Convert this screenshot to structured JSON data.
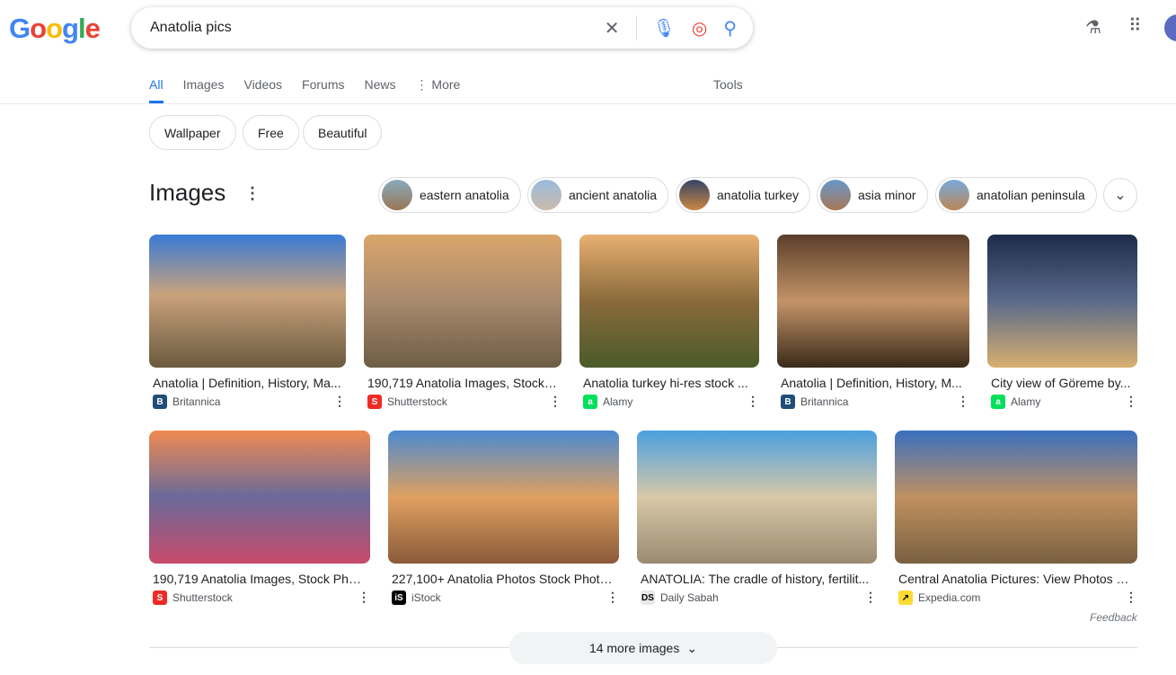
{
  "logo": "Google",
  "search": {
    "query": "Anatolia pics"
  },
  "tabs": [
    "All",
    "Images",
    "Videos",
    "Forums",
    "News",
    "More"
  ],
  "tools": "Tools",
  "chips": [
    "Wallpaper",
    "Free",
    "Beautiful"
  ],
  "images_heading": "Images",
  "related": [
    "eastern anatolia",
    "ancient anatolia",
    "anatolia turkey",
    "asia minor",
    "anatolian peninsula"
  ],
  "results": [
    {
      "title": "Anatolia | Definition, History, Ma...",
      "source": "Britannica",
      "fav": "B",
      "color": "#1f4e79"
    },
    {
      "title": "190,719 Anatolia Images, Stock P...",
      "source": "Shutterstock",
      "fav": "S",
      "color": "#ee2b24"
    },
    {
      "title": "Anatolia turkey hi-res stock ...",
      "source": "Alamy",
      "fav": "a",
      "color": "#00e05a"
    },
    {
      "title": "Anatolia | Definition, History, M...",
      "source": "Britannica",
      "fav": "B",
      "color": "#1f4e79"
    },
    {
      "title": "City view of Göreme by...",
      "source": "Alamy",
      "fav": "a",
      "color": "#00e05a"
    },
    {
      "title": "190,719 Anatolia Images, Stock Phot...",
      "source": "Shutterstock",
      "fav": "S",
      "color": "#ee2b24"
    },
    {
      "title": "227,100+ Anatolia Photos Stock Photo...",
      "source": "iStock",
      "fav": "iS",
      "color": "#000000"
    },
    {
      "title": "ANATOLIA: The cradle of history, fertilit...",
      "source": "Daily Sabah",
      "fav": "DS",
      "color": "#e8e8e8"
    },
    {
      "title": "Central Anatolia Pictures: View Photos &...",
      "source": "Expedia.com",
      "fav": "↗",
      "color": "#fddb32"
    }
  ],
  "feedback": "Feedback",
  "more_images": "14 more images"
}
